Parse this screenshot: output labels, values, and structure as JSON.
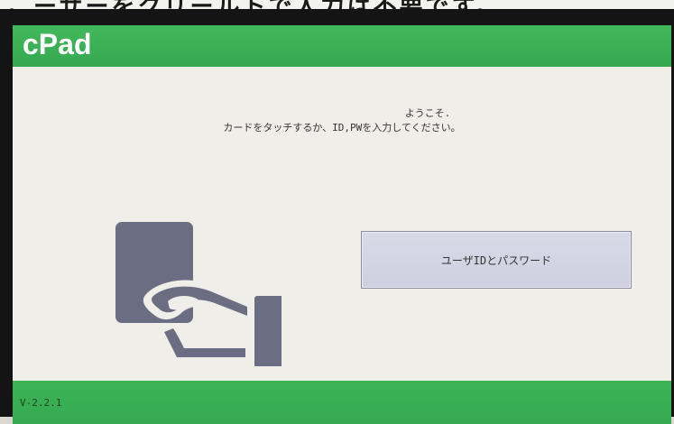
{
  "top_caption": "。ーサーをクリールトで人力は不要です。",
  "app": {
    "title": "cPad"
  },
  "welcome": {
    "line1": "ようこそ.",
    "line2": "カードをタッチするか、ID,PWを入力してください。"
  },
  "card_icon": "card-touch-icon",
  "login_button": {
    "label": "ユーザIDとパスワード"
  },
  "footer": {
    "version": "V-2.2.1"
  },
  "colors": {
    "header": "#3cb357",
    "background": "#efeee9",
    "icon": "#6b6d82",
    "button": "#d6d7e6"
  }
}
